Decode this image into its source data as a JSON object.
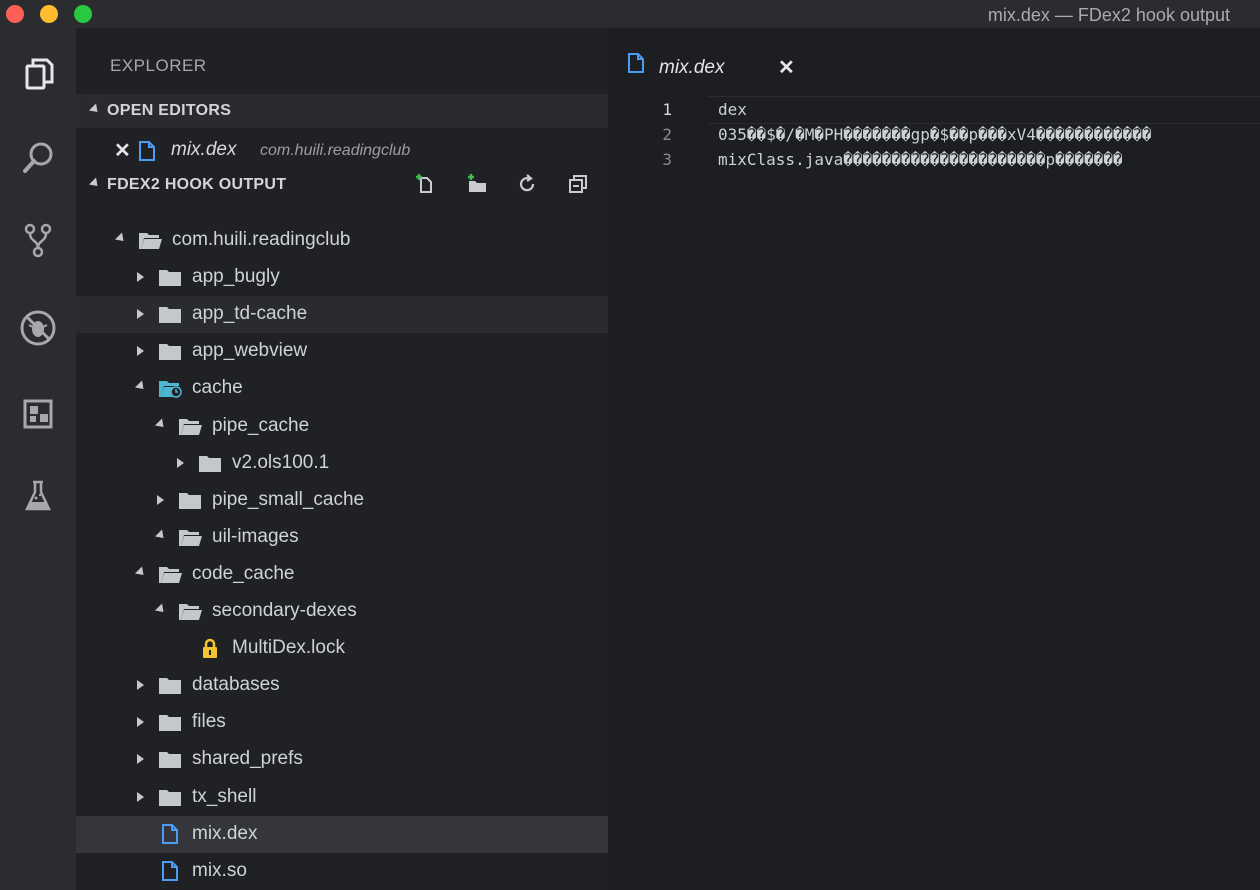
{
  "window": {
    "title": "mix.dex — FDex2 hook output"
  },
  "activity_bar": {
    "icons": [
      "files-icon",
      "search-icon",
      "source-control-icon",
      "debug-icon",
      "extensions-icon",
      "flask-icon"
    ]
  },
  "sidebar": {
    "title": "EXPLORER",
    "open_editors": {
      "label": "OPEN EDITORS",
      "items": [
        {
          "name": "mix.dex",
          "path": "com.huili.readingclub"
        }
      ]
    },
    "folder": {
      "label": "FDEX2 HOOK OUTPUT",
      "tree": [
        {
          "label": "com.huili.readingclub",
          "depth": 0,
          "state": "open",
          "icon": "folder-open-icon"
        },
        {
          "label": "app_bugly",
          "depth": 1,
          "state": "closed",
          "icon": "folder-icon"
        },
        {
          "label": "app_td-cache",
          "depth": 1,
          "state": "closed",
          "icon": "folder-icon"
        },
        {
          "label": "app_webview",
          "depth": 1,
          "state": "closed",
          "icon": "folder-icon"
        },
        {
          "label": "cache",
          "depth": 1,
          "state": "open",
          "icon": "cache-folder-icon"
        },
        {
          "label": "pipe_cache",
          "depth": 2,
          "state": "open",
          "icon": "folder-open-icon"
        },
        {
          "label": "v2.ols100.1",
          "depth": 3,
          "state": "closed",
          "icon": "folder-icon"
        },
        {
          "label": "pipe_small_cache",
          "depth": 2,
          "state": "closed",
          "icon": "folder-icon"
        },
        {
          "label": "uil-images",
          "depth": 2,
          "state": "open",
          "icon": "folder-open-icon"
        },
        {
          "label": "code_cache",
          "depth": 1,
          "state": "open",
          "icon": "folder-open-icon"
        },
        {
          "label": "secondary-dexes",
          "depth": 2,
          "state": "open",
          "icon": "folder-open-icon"
        },
        {
          "label": "MultiDex.lock",
          "depth": 3,
          "state": "file",
          "icon": "lock-icon"
        },
        {
          "label": "databases",
          "depth": 1,
          "state": "closed",
          "icon": "folder-icon"
        },
        {
          "label": "files",
          "depth": 1,
          "state": "closed",
          "icon": "folder-icon"
        },
        {
          "label": "shared_prefs",
          "depth": 1,
          "state": "closed",
          "icon": "folder-icon"
        },
        {
          "label": "tx_shell",
          "depth": 1,
          "state": "closed",
          "icon": "folder-icon"
        },
        {
          "label": "mix.dex",
          "depth": 1,
          "state": "file",
          "icon": "file-icon"
        },
        {
          "label": "mix.so",
          "depth": 1,
          "state": "file",
          "icon": "file-icon"
        }
      ]
    }
  },
  "editor": {
    "tab": {
      "label": "mix.dex"
    },
    "lines": [
      {
        "num": "1",
        "text": "dex"
      },
      {
        "num": "2",
        "text": "035��$�/�M�PH�������gp�$��p���xV4������������"
      },
      {
        "num": "3",
        "text": "mixClass.java���������������������p�������"
      }
    ]
  },
  "colors": {
    "background": "#1e1f22",
    "sidebar": "#202124",
    "activity_bar": "#2b2c2f",
    "folder_icon": "#c4c7cc",
    "file_icon": "#4a9cf5",
    "lock_icon": "#f4c430",
    "cache_icon": "#4db6d0"
  }
}
